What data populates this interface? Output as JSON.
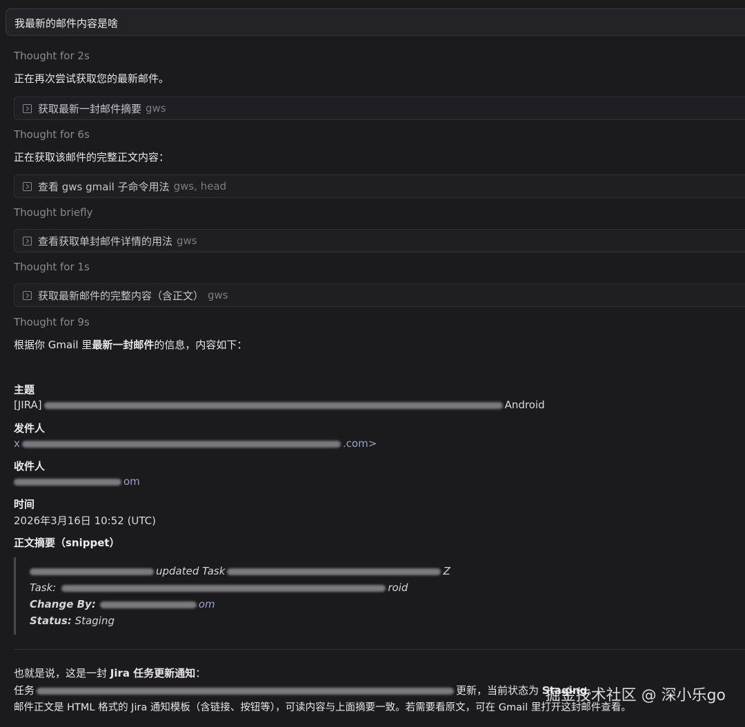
{
  "query": "我最新的邮件内容是啥",
  "steps": {
    "t1": "Thought for 2s",
    "s1": "正在再次尝试获取您的最新邮件。",
    "tool1_label": "获取最新一封邮件摘要",
    "tool1_arg": "gws",
    "t2": "Thought for 6s",
    "s2": "正在获取该邮件的完整正文内容：",
    "tool2_label": "查看 gws gmail 子命令用法",
    "tool2_arg": "gws, head",
    "t3": "Thought briefly",
    "tool3_label": "查看获取单封邮件详情的用法",
    "tool3_arg": "gws",
    "t4": "Thought for 1s",
    "tool4_label": "获取最新邮件的完整内容（含正文）",
    "tool4_arg": "gws",
    "t5": "Thought for 9s"
  },
  "intro": {
    "pre": "根据你 Gmail 里",
    "bold": "最新一封邮件",
    "post": "的信息，内容如下："
  },
  "email": {
    "subject_label": "主题",
    "subject_prefix": "[JIRA]",
    "subject_suffix": "Android",
    "sender_label": "发件人",
    "sender_prefix": "x",
    "sender_suffix": ".com>",
    "recipient_label": "收件人",
    "recipient_suffix": "om",
    "time_label": "时间",
    "time_value": "2026年3月16日 10:52 (UTC)",
    "snippet_label": "正文摘要（snippet）"
  },
  "snippet": {
    "line1_mid": "updated Task",
    "line1_end": "Z",
    "task_label": "Task:",
    "task_end": "roid",
    "change_label": "Change By:",
    "change_end": "om",
    "status_label": "Status:",
    "status_value": "Staging"
  },
  "summary": {
    "line1_pre": "也就是说，这是一封 ",
    "line1_bold": "Jira 任务更新通知",
    "line1_post": "：",
    "line2_pre": "任务",
    "line2_mid": "更新，当前状态为 ",
    "line2_bold": "Staging",
    "line2_post": "。",
    "line3": "邮件正文是 HTML 格式的 Jira 通知模板（含链接、按钮等），可读内容与上面摘要一致。若需要看原文，可在 Gmail 里打开这封邮件查看。"
  },
  "watermark": "掘金技术社区 @ 深小乐go"
}
